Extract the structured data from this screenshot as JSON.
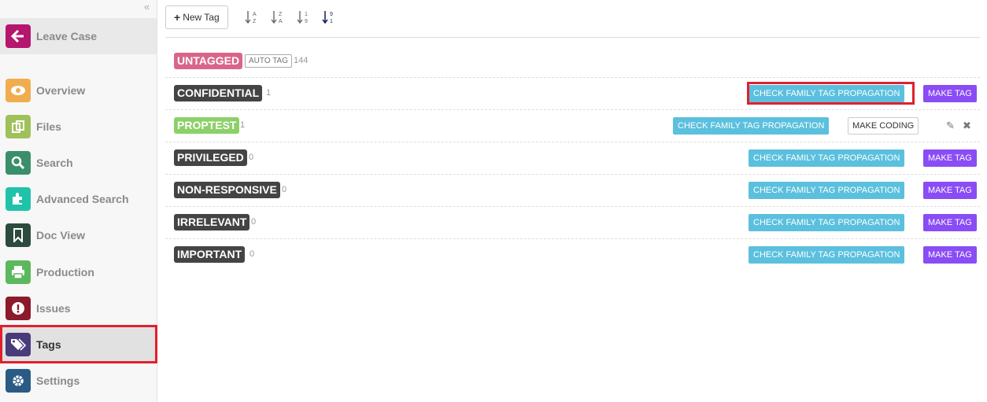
{
  "sidebar": {
    "collapse_icon": "double-chevron-left-icon",
    "leave": {
      "label": "Leave Case",
      "icon": "arrow-left-icon",
      "color": "#b5166e"
    },
    "items": [
      {
        "label": "Overview",
        "icon": "eye-icon",
        "color": "#f0ad4e"
      },
      {
        "label": "Files",
        "icon": "copy-icon",
        "color": "#a0c15a"
      },
      {
        "label": "Search",
        "icon": "search-icon",
        "color": "#3a8f6a"
      },
      {
        "label": "Advanced Search",
        "icon": "puzzle-icon",
        "color": "#1fc3aa"
      },
      {
        "label": "Doc View",
        "icon": "bookmark-icon",
        "color": "#2d4a3e"
      },
      {
        "label": "Production",
        "icon": "print-icon",
        "color": "#5cb85c"
      },
      {
        "label": "Issues",
        "icon": "exclamation-icon",
        "color": "#8b1a2b"
      },
      {
        "label": "Tags",
        "icon": "tags-icon",
        "color": "#4a3b7a",
        "active": true
      },
      {
        "label": "Settings",
        "icon": "gear-icon",
        "color": "#2a5b84"
      }
    ]
  },
  "toolbar": {
    "new_tag_label": "New Tag",
    "sort_icons": [
      "sort-alpha-asc-icon",
      "sort-alpha-desc-icon",
      "sort-numeric-asc-icon",
      "sort-numeric-desc-icon"
    ]
  },
  "untagged": {
    "label": "UNTAGGED",
    "badge": "AUTO TAG",
    "count": "144",
    "color": "#d9668a"
  },
  "tags": [
    {
      "name": "CONFIDENTIAL",
      "count": "1",
      "color": "#444444",
      "check_label": "CHECK FAMILY TAG PROPAGATION",
      "make_label": "MAKE TAG"
    },
    {
      "name": "PROPTEST",
      "count": "1",
      "color": "#8cd069",
      "check_label": "CHECK FAMILY TAG PROPAGATION",
      "make_label": "MAKE CODING"
    },
    {
      "name": "PRIVILEGED",
      "count": "0",
      "color": "#444444",
      "check_label": "CHECK FAMILY TAG PROPAGATION",
      "make_label": "MAKE TAG"
    },
    {
      "name": "NON-RESPONSIVE",
      "count": "0",
      "color": "#444444",
      "check_label": "CHECK FAMILY TAG PROPAGATION",
      "make_label": "MAKE TAG"
    },
    {
      "name": "IRRELEVANT",
      "count": "0",
      "color": "#444444",
      "check_label": "CHECK FAMILY TAG PROPAGATION",
      "make_label": "MAKE TAG"
    },
    {
      "name": "IMPORTANT",
      "count": "0",
      "color": "#444444",
      "check_label": "CHECK FAMILY TAG PROPAGATION",
      "make_label": "MAKE TAG"
    }
  ],
  "row_actions": [
    "pencil-icon",
    "close-icon"
  ]
}
